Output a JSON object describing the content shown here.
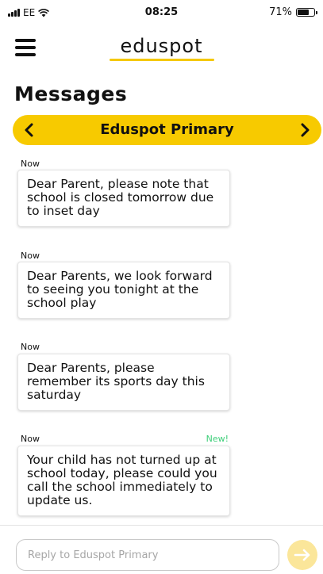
{
  "status_bar": {
    "carrier": "EE",
    "time": "08:25",
    "battery": "71%",
    "battery_level": 0.71
  },
  "header": {
    "brand": "eduspot",
    "accent_color": "#f7ca00"
  },
  "page_title": "Messages",
  "school_selector": {
    "name": "Eduspot Primary",
    "prev_icon": "chevron-left-icon",
    "next_icon": "chevron-right-icon"
  },
  "messages": [
    {
      "time": "Now",
      "text": "Dear Parent, please note that school is closed tomorrow due to inset day",
      "badge": ""
    },
    {
      "time": "Now",
      "text": "Dear Parents, we look forward to seeing you tonight at the school play",
      "badge": ""
    },
    {
      "time": "Now",
      "text": "Dear Parents, please remember its sports day this saturday",
      "badge": ""
    },
    {
      "time": "Now",
      "text": "Your child has not turned up at school today, please could you call the school immediately to update us.",
      "badge": "New!"
    }
  ],
  "reply": {
    "placeholder": "Reply to Eduspot Primary",
    "value": "",
    "send_icon": "arrow-right-icon"
  }
}
